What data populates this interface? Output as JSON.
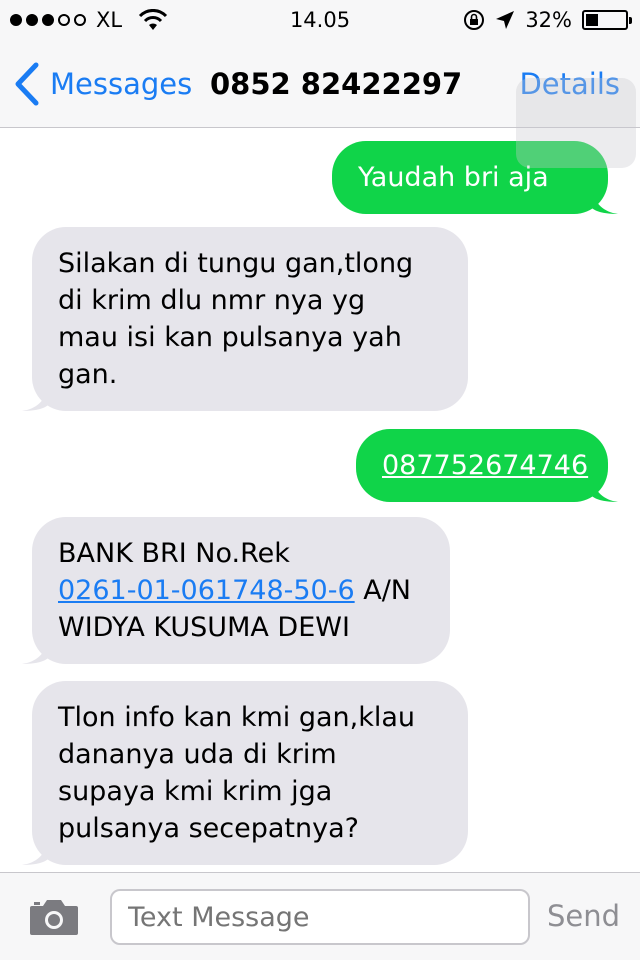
{
  "status_bar": {
    "carrier": "XL",
    "time": "14.05",
    "battery": "32%",
    "battery_level": 0.32
  },
  "nav": {
    "back_label": "Messages",
    "title": "0852 82422297",
    "details_label": "Details"
  },
  "messages": [
    {
      "direction": "outgoing",
      "lines": [
        "Yaudah bri aja"
      ]
    },
    {
      "direction": "incoming",
      "lines": [
        "Silakan di tungu gan,tlong",
        "di krim dlu nmr nya yg",
        "mau isi kan pulsanya yah",
        "gan."
      ]
    },
    {
      "direction": "outgoing",
      "link": "087752674746"
    },
    {
      "direction": "incoming",
      "line1": "BANK BRI No.Rek",
      "link": "0261-01-061748-50-6",
      "after_link": " A/N",
      "line3": "WIDYA KUSUMA DEWI"
    },
    {
      "direction": "incoming",
      "lines": [
        "Tlon info kan kmi gan,klau",
        "dananya uda di krim",
        "supaya kmi krim jga",
        "pulsanya secepatnya?"
      ]
    }
  ],
  "input": {
    "placeholder": "Text Message",
    "send_label": "Send"
  },
  "colors": {
    "accent": "#1a7cf3",
    "outgoing_bubble": "#10d449",
    "incoming_bubble": "#e6e5eb"
  }
}
